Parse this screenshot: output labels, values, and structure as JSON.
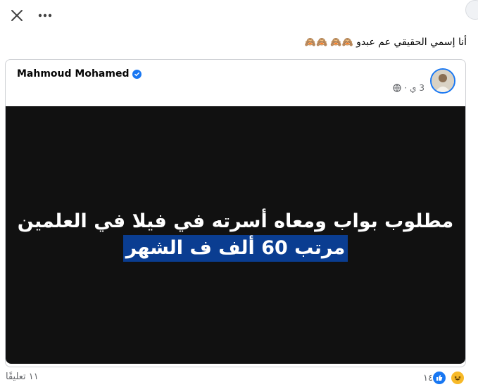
{
  "caption": {
    "text": "أنا إسمي الحقيقي عم عبدو",
    "emoji": "🙈🙈 🙈🙈"
  },
  "shared_post": {
    "author": "Mahmoud Mohamed",
    "time": "3 ي",
    "audience_icon": "globe-icon",
    "media_lines": [
      "مطلوب بواب ومعاه أسرته في فيلا في العلمين",
      "مرتب 60 ألف ف الشهر"
    ]
  },
  "footer": {
    "comments": "١١ تعليقًا",
    "reactions_count": "١٤",
    "reaction_icons": [
      "like-icon",
      "haha-icon"
    ]
  },
  "colors": {
    "accent": "#1877f2",
    "media_bg": "#111111",
    "highlight": "#0a3d91",
    "muted_text": "#65676b"
  }
}
